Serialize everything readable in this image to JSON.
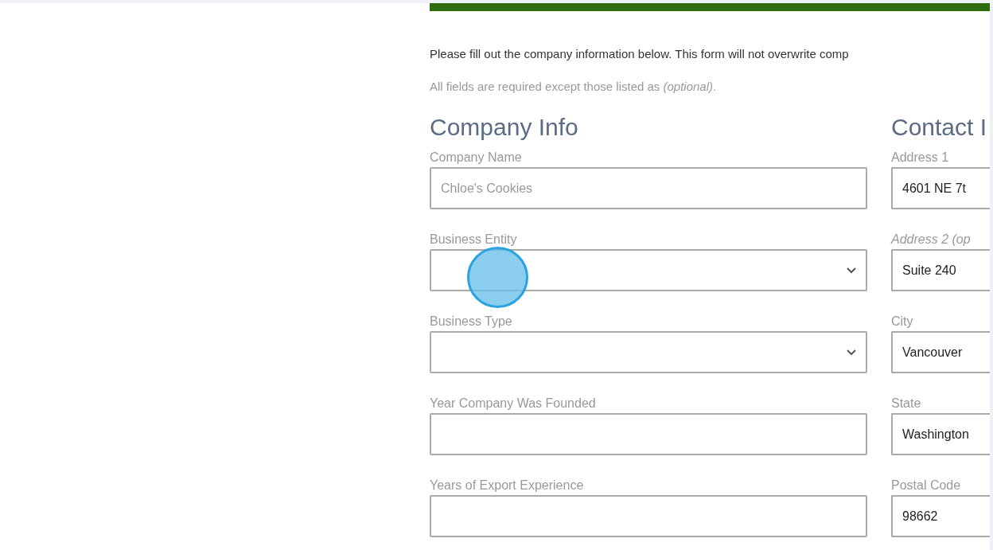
{
  "intro": "Please fill out the company information below. This form will not overwrite comp",
  "note": "All fields are required except those listed as *(optional)*.",
  "company_info": {
    "heading": "Company Info",
    "fields": [
      {
        "kind": "text",
        "label": "Company Name",
        "placeholder": "Chloe's Cookies"
      },
      {
        "kind": "select",
        "label": "Business Entity"
      },
      {
        "kind": "select",
        "label": "Business Type"
      },
      {
        "kind": "text",
        "label": "Year Company Was Founded"
      },
      {
        "kind": "text",
        "label": "Years of Export Experience"
      }
    ]
  },
  "contact_info": {
    "heading": "Contact I",
    "fields": [
      {
        "kind": "text",
        "label": "Address 1",
        "value": "4601 NE 7t"
      },
      {
        "kind": "text",
        "label": "Address 2 (op",
        "optional": true,
        "value": "Suite 240"
      },
      {
        "kind": "text",
        "label": "City",
        "value": "Vancouver"
      },
      {
        "kind": "text",
        "label": "State",
        "value": "Washington"
      },
      {
        "kind": "text",
        "label": "Postal Code",
        "value": "98662"
      }
    ]
  }
}
